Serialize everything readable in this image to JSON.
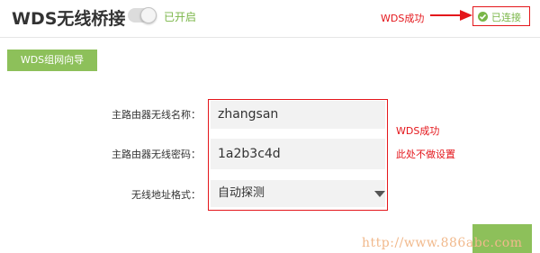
{
  "header": {
    "title": "WDS无线桥接",
    "toggle": {
      "on": true,
      "status_label": "已开启"
    },
    "connection_status": {
      "label": "已连接",
      "icon": "check-circle-icon"
    }
  },
  "wizard_button": {
    "label": "WDS组网向导"
  },
  "form": {
    "ssid": {
      "label": "主路由器无线名称：",
      "value": "zhangsan"
    },
    "password": {
      "label": "主路由器无线密码：",
      "value": "1a2b3c4d"
    },
    "address_format": {
      "label": "无线地址格式：",
      "value": "自动探测"
    }
  },
  "annotations": {
    "top_success": "WDS成功",
    "form_success": "WDS成功",
    "form_note": "此处不做设置"
  },
  "watermark": "http://www.886abc.com",
  "colors": {
    "accent_green": "#8dc05a",
    "status_green": "#7ab648",
    "annotation_red": "#e4161b",
    "field_bg": "#f2f2f2",
    "watermark": "#f1b98c"
  }
}
